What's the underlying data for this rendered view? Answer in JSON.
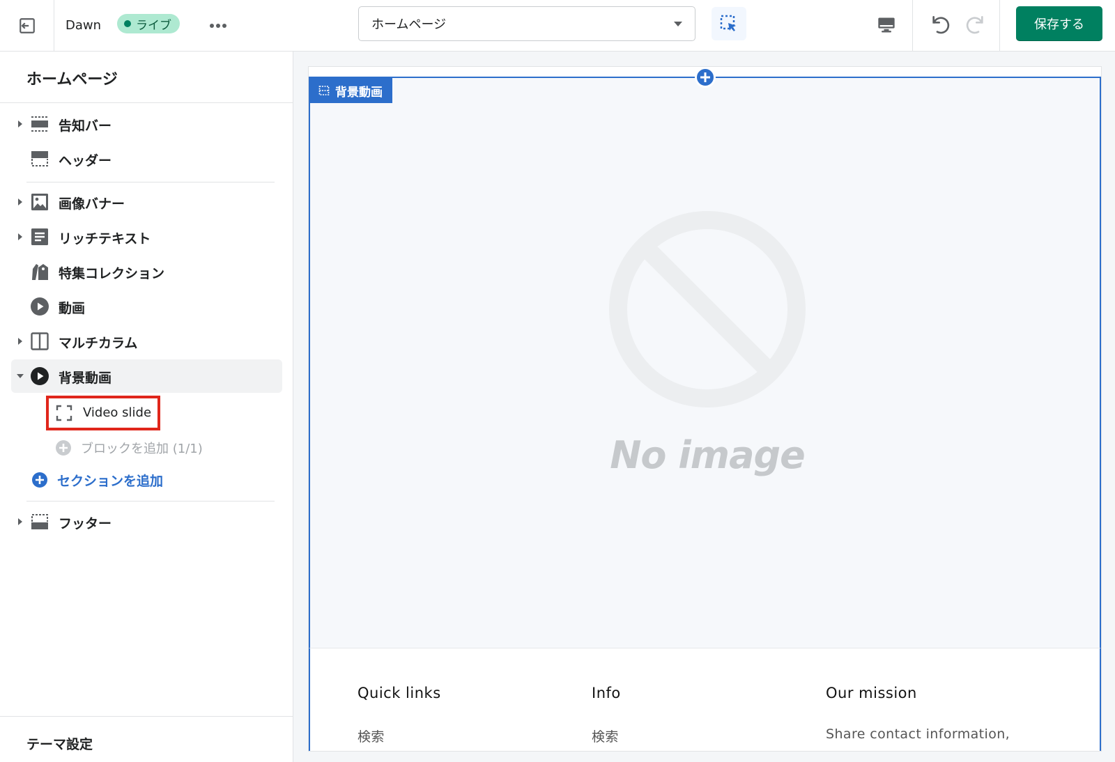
{
  "topbar": {
    "theme_name": "Dawn",
    "live_badge": "ライブ",
    "page_select": "ホームページ",
    "save_label": "保存する"
  },
  "sidebar": {
    "title": "ホームページ",
    "items": [
      {
        "label": "告知バー",
        "icon": "announcement-bar-icon",
        "expandable": true
      },
      {
        "label": "ヘッダー",
        "icon": "header-icon",
        "expandable": false
      },
      {
        "label": "画像バナー",
        "icon": "image-icon",
        "expandable": true
      },
      {
        "label": "リッチテキスト",
        "icon": "text-block-icon",
        "expandable": true
      },
      {
        "label": "特集コレクション",
        "icon": "collection-tag-icon",
        "expandable": false
      },
      {
        "label": "動画",
        "icon": "play-circle-icon",
        "expandable": false
      },
      {
        "label": "マルチカラム",
        "icon": "columns-icon",
        "expandable": true
      },
      {
        "label": "背景動画",
        "icon": "play-circle-icon",
        "expandable": true,
        "expanded": true
      },
      {
        "label": "フッター",
        "icon": "footer-icon",
        "expandable": true
      }
    ],
    "block_label": "Video slide",
    "add_block_label": "ブロックを追加 (1/1)",
    "add_section_label": "セクションを追加",
    "theme_settings_label": "テーマ設定"
  },
  "preview": {
    "section_tag": "背景動画",
    "placeholder_text": "No image",
    "footer_columns": [
      {
        "heading": "Quick links",
        "text": "検索"
      },
      {
        "heading": "Info",
        "text": "検索"
      },
      {
        "heading": "Our mission",
        "text": "Share contact information,"
      }
    ]
  },
  "colors": {
    "accent": "#2c6ecb",
    "save": "#008060",
    "live_badge_bg": "#aee9d1",
    "highlight": "#e0261b"
  }
}
